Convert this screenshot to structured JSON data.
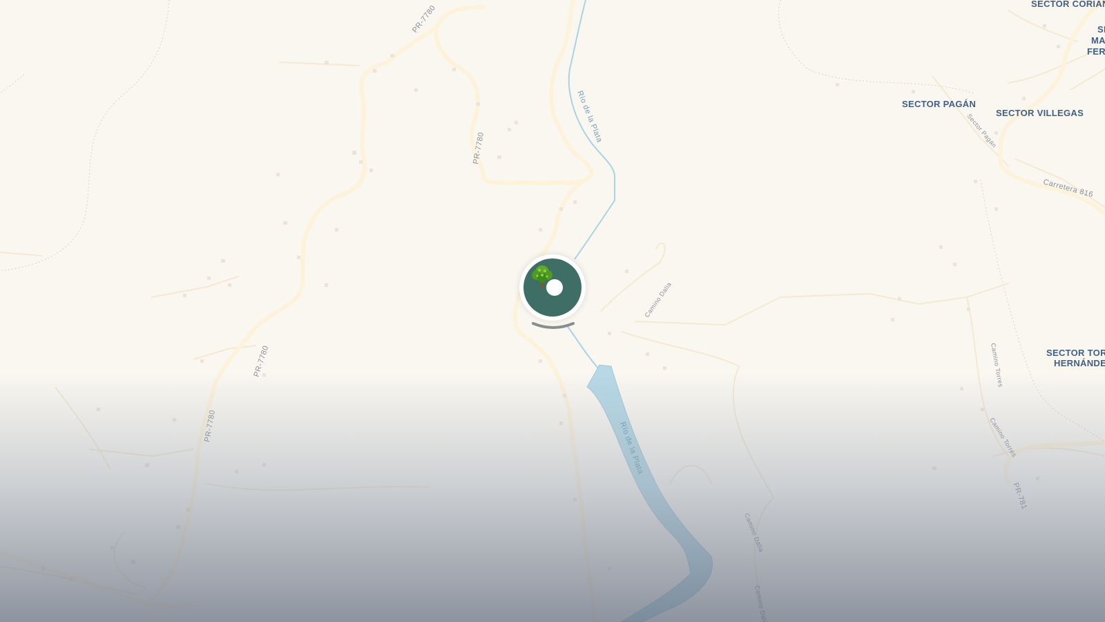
{
  "map": {
    "roads": [
      {
        "id": "pr7780-top",
        "label": "PR-7780"
      },
      {
        "id": "pr7780-mid",
        "label": "PR-7780"
      },
      {
        "id": "pr7780-left1",
        "label": "PR-7780"
      },
      {
        "id": "pr7780-left2",
        "label": "PR-7780"
      },
      {
        "id": "sector-pagan-road",
        "label": "Sector Pagán"
      },
      {
        "id": "carretera-816",
        "label": "Carretera 816"
      },
      {
        "id": "camino-dalia-1",
        "label": "Camino Dalia"
      },
      {
        "id": "camino-dalia-2",
        "label": "Camino Dalia"
      },
      {
        "id": "camino-dalia-3",
        "label": "Camino Dalia"
      },
      {
        "id": "camino-torres-1",
        "label": "Camino Torres"
      },
      {
        "id": "camino-torres-2",
        "label": "Camino Torres"
      },
      {
        "id": "pr781",
        "label": "PR-781"
      }
    ],
    "rivers": [
      {
        "id": "rio-1",
        "label": "Río de la Plata"
      },
      {
        "id": "rio-2",
        "label": "Río de la Plata"
      }
    ],
    "places": [
      {
        "id": "coriano",
        "label": "SECTOR CORIAN"
      },
      {
        "id": "sm-line1",
        "label": "SE"
      },
      {
        "id": "sm-line2",
        "label": "MA"
      },
      {
        "id": "sm-line3",
        "label": "FER"
      },
      {
        "id": "pagan",
        "label": "SECTOR PAGÁN"
      },
      {
        "id": "villegas",
        "label": "SECTOR VILLEGAS"
      },
      {
        "id": "torres-line1",
        "label": "SECTOR TORI"
      },
      {
        "id": "torres-line2",
        "label": "HERNÁNDE"
      }
    ],
    "marker": {
      "icon": "tree-icon",
      "color": "#3f6e66"
    },
    "colors": {
      "background": "#faf7f1",
      "road": "#fdf2da",
      "river": "#a9d3e2",
      "river_fill": "#b7d8e5",
      "place_label": "#3f5f86"
    }
  }
}
